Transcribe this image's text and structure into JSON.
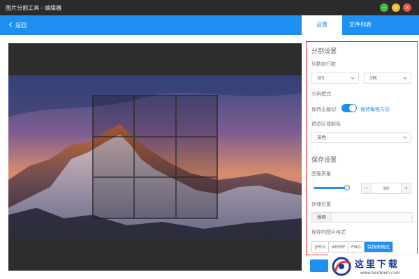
{
  "window": {
    "title": "图片分割工具 - 编辑器",
    "min_glyph": "–",
    "max_glyph": "o",
    "close_glyph": "×"
  },
  "nav": {
    "back_label": "返回",
    "tabs": [
      {
        "label": "设置",
        "active": true
      },
      {
        "label": "文件列表",
        "active": false
      }
    ]
  },
  "preview": {
    "grid_columns": 3,
    "grid_rows": 3
  },
  "split_settings": {
    "title": "分割设置",
    "count_label": "列数和行数",
    "rows_value": "3行",
    "columns_value": "3列",
    "mode_label": "分割模式",
    "mode_off_label": "保持无裁切",
    "mode_on_label": "保持每格方形",
    "mode_enabled": true,
    "preview_color_label": "预览区域颜色",
    "preview_color_value": "深色"
  },
  "save_settings": {
    "title": "保存设置",
    "quality_label": "图像质量",
    "quality_value": "90",
    "quality_fraction": 0.9,
    "minus_glyph": "−",
    "plus_glyph": "+",
    "location_label": "存储位置",
    "choose_label": "选择",
    "format_label": "保存的图片格式",
    "formats": [
      "JPEG",
      "WEBP",
      "PNG",
      "保持原格式"
    ],
    "selected_format": "保持原格式"
  },
  "watermark": {
    "text": "这里下载",
    "url": "www.herdown.com"
  },
  "colors": {
    "accent": "#1e90f1",
    "titlebar": "#2b2b2b",
    "highlight_border": "#e33"
  }
}
